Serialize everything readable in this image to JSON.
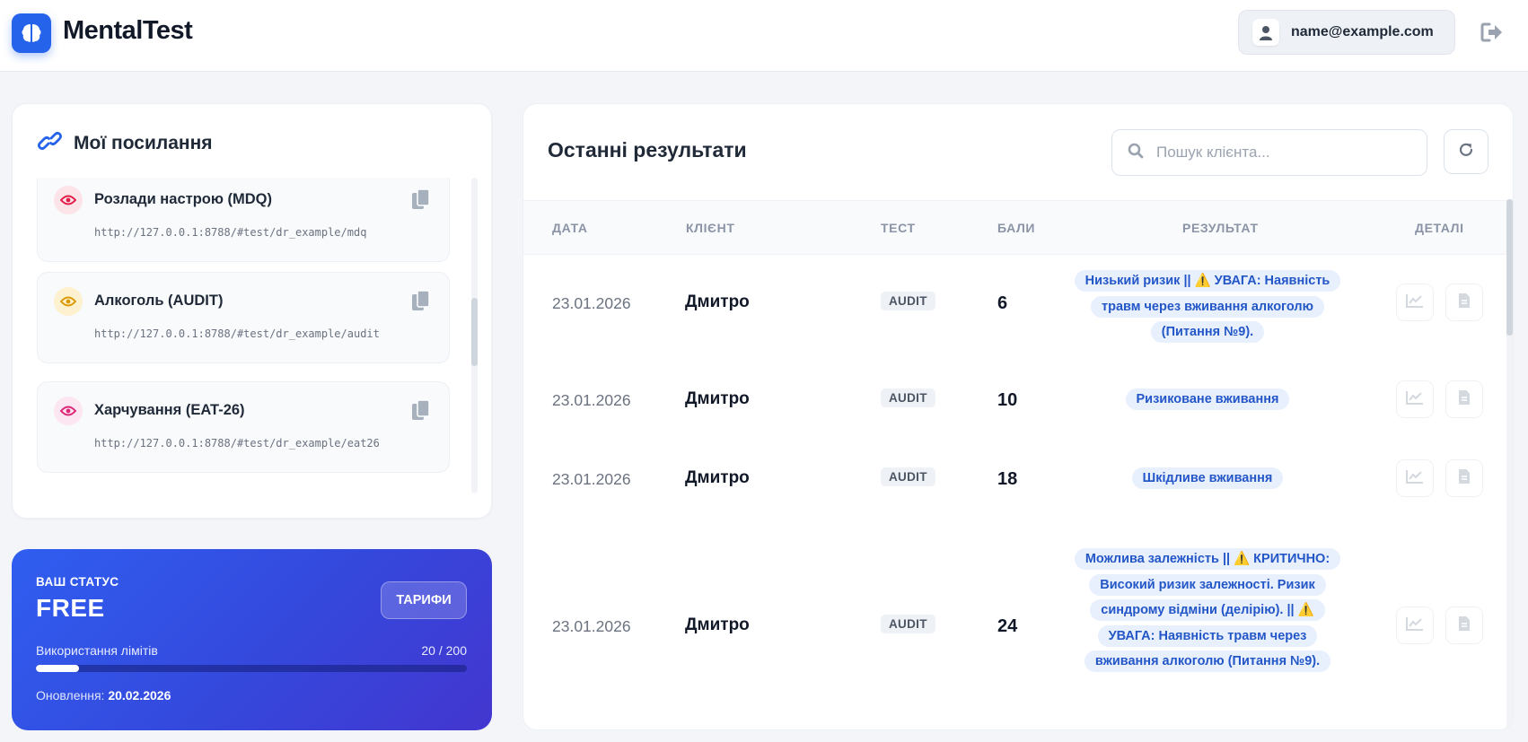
{
  "header": {
    "app_name": "MentalTest",
    "user_email": "name@example.com"
  },
  "links": {
    "title": "Мої посилання",
    "items": [
      {
        "name": "Розлади настрою (MDQ)",
        "url": "http://127.0.0.1:8788/#test/dr_example/mdq",
        "eye_color": "#e11d48",
        "eye_bg": "#fde4e8"
      },
      {
        "name": "Алкоголь (AUDIT)",
        "url": "http://127.0.0.1:8788/#test/dr_example/audit",
        "eye_color": "#d99a06",
        "eye_bg": "#fdf1cf"
      },
      {
        "name": "Харчування (EAT-26)",
        "url": "http://127.0.0.1:8788/#test/dr_example/eat26",
        "eye_color": "#db2777",
        "eye_bg": "#fce6f1"
      }
    ]
  },
  "status": {
    "label": "ВАШ СТАТУС",
    "plan": "FREE",
    "tariff_button": "ТАРИФИ",
    "usage_label": "Використання лімітів",
    "usage_value": "20 / 200",
    "usage_fraction": 0.1,
    "renew_label": "Оновлення:",
    "renew_date": "20.02.2026"
  },
  "results": {
    "title": "Останні результати",
    "search_placeholder": "Пошук клієнта...",
    "columns": {
      "date": "ДАТА",
      "client": "КЛІЄНТ",
      "test": "ТЕСТ",
      "score": "БАЛИ",
      "result": "РЕЗУЛЬТАТ",
      "details": "ДЕТАЛІ"
    },
    "rows": [
      {
        "date": "23.01.2026",
        "client": "Дмитро",
        "test": "AUDIT",
        "score": "6",
        "result": "Низький ризик || ⚠️ УВАГА: Наявність травм через вживання алкоголю (Питання №9)."
      },
      {
        "date": "23.01.2026",
        "client": "Дмитро",
        "test": "AUDIT",
        "score": "10",
        "result": "Ризиковане вживання"
      },
      {
        "date": "23.01.2026",
        "client": "Дмитро",
        "test": "AUDIT",
        "score": "18",
        "result": "Шкідливе вживання"
      },
      {
        "date": "23.01.2026",
        "client": "Дмитро",
        "test": "AUDIT",
        "score": "24",
        "result": "Можлива залежність || ⚠️ КРИТИЧНО: Високий ризик залежності. Ризик синдрому відміни (делірію). || ⚠️ УВАГА: Наявність травм через вживання алкоголю (Питання №9)."
      }
    ]
  },
  "colors": {
    "accent": "#2563eb",
    "badge_bg": "#e8f0fd",
    "badge_text": "#2356c7"
  },
  "icons": {
    "logo": "brain-icon",
    "user": "user-icon",
    "logout": "sign-out-icon",
    "links_title": "link-icon",
    "link_view": "eye-icon",
    "link_copy": "copy-icon",
    "search": "search-icon",
    "refresh": "refresh-icon",
    "chart": "chart-line-icon",
    "document": "file-icon"
  }
}
